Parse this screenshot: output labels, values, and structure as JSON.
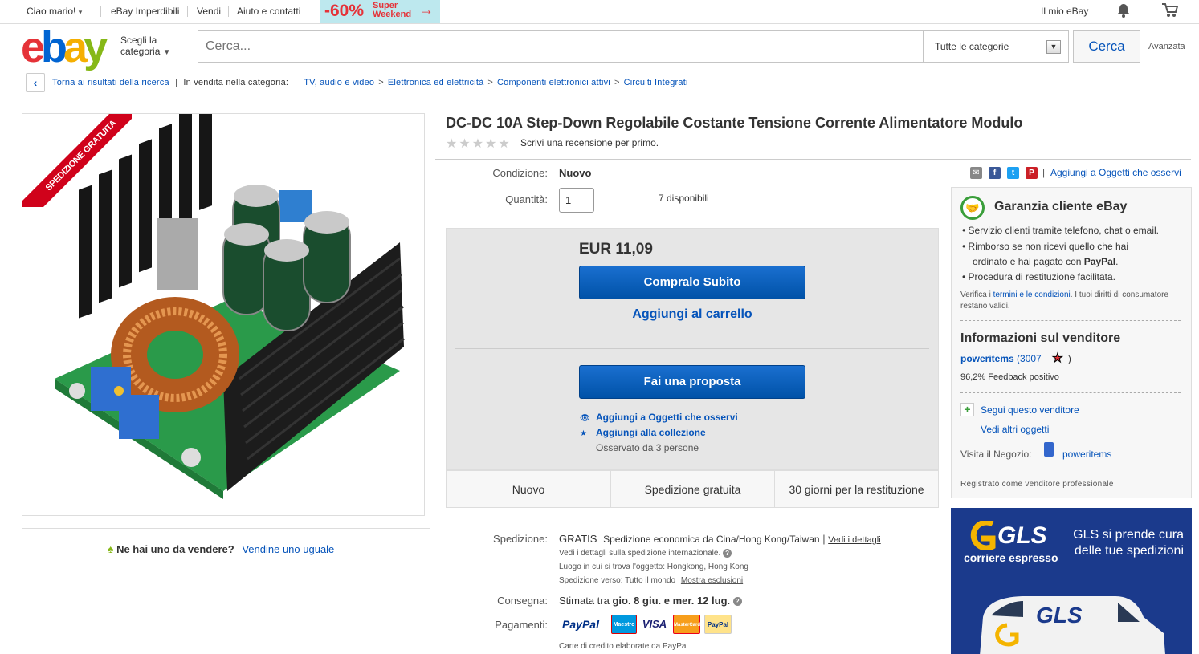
{
  "topbar": {
    "greeting_prefix": "Ciao ",
    "greeting_name": "mario!",
    "caret": "▾",
    "links": [
      "eBay Imperdibili",
      "Vendi",
      "Aiuto e contatti"
    ],
    "promo_pct": "-60%",
    "promo_l1": "Super",
    "promo_l2": "Weekend",
    "promo_arrow": "→",
    "my_ebay": "Il mio eBay",
    "bell": "🔔",
    "cart": "🛒"
  },
  "header": {
    "logo": {
      "e": "e",
      "b": "b",
      "a": "a",
      "y": "y"
    },
    "shop_by_l1": "Scegli la",
    "shop_by_l2": "categoria",
    "shop_by_caret": "▼",
    "search_placeholder": "Cerca...",
    "category": "Tutte le categorie",
    "dropdown": "▼",
    "search_button": "Cerca",
    "advanced": "Avanzata"
  },
  "breadcrumb": {
    "back_icon": "‹",
    "back_text": "Torna ai risultati della ricerca",
    "pipe": "|",
    "in_category": "In vendita nella categoria:",
    "sep": ">",
    "cats": [
      "TV, audio e video",
      "Elettronica ed elettricità",
      "Componenti elettronici attivi",
      "Circuiti Integrati"
    ]
  },
  "item": {
    "ribbon": "SPEDIZIONE GRATUITA",
    "title": "DC-DC 10A Step-Down Regolabile Costante Tensione Corrente Alimentatore Modulo",
    "stars": "★★★★★",
    "review_link": "Scrivi una recensione per primo.",
    "condition_label": "Condizione:",
    "condition": "Nuovo",
    "quantity_label": "Quantità:",
    "quantity": "1",
    "available": "7 disponibili",
    "price": "EUR 11,09",
    "buy_now": "Compralo Subito",
    "add_cart": "Aggiungi al carrello",
    "best_offer": "Fai una proposta",
    "watch_icon": "👁",
    "watch": "Aggiungi a Oggetti che osservi",
    "collect_icon": "★",
    "collect": "Aggiungi alla collezione",
    "observed": "Osservato da 3 persone",
    "features": [
      "Nuovo",
      "Spedizione gratuita",
      "30 giorni per la restituzione"
    ],
    "sell_one_icon": "♠",
    "sell_one_q": "Ne hai uno da vendere?",
    "sell_one_link": "Vendine uno uguale"
  },
  "shipping": {
    "label": "Spedizione:",
    "free": "GRATIS",
    "desc": "Spedizione economica da Cina/Hong Kong/Taiwan",
    "pipe": "|",
    "details": "Vedi i dettagli",
    "intl": "Vedi i dettagli sulla spedizione internazionale.",
    "help": "?",
    "loc_label": "Luogo in cui si trova l'oggetto:",
    "loc": "Hongkong, Hong Kong",
    "to_label": "Spedizione verso:",
    "to": "Tutto il mondo",
    "excl": "Mostra esclusioni",
    "delivery_label": "Consegna:",
    "delivery_prefix": "Stimata tra ",
    "delivery_dates": "gio. 8 giu. e mer. 12 lug.",
    "pay_label": "Pagamenti:",
    "paypal": "PayPal",
    "maestro": "Maestro",
    "visa": "VISA",
    "mastercard": "MasterCard",
    "ppcredit": "PayPal",
    "credit_note": "Carte di credito elaborate da PayPal"
  },
  "share": {
    "email": "✉",
    "fb": "f",
    "tw": "t",
    "pin": "P",
    "pipe": "|",
    "watch_link": "Aggiungi a Oggetti che osservi"
  },
  "guarantee": {
    "icon": "🤝",
    "title": "Garanzia cliente eBay",
    "bullet": "•",
    "items": [
      "Servizio clienti tramite telefono, chat o email.",
      "Rimborso se non ricevi quello che hai",
      "ordinato e hai pagato con ",
      "PayPal",
      ".",
      "Procedura di restituzione facilitata."
    ],
    "verify_l1_a": "Verifica i ",
    "verify_link": "termini e le condizioni",
    "verify_l1_b": ". I tuoi diritti di consumatore",
    "verify_l2": "restano validi."
  },
  "seller": {
    "title": "Informazioni sul venditore",
    "name": "poweritems",
    "score": "(3007",
    "star": "★",
    "close": ")",
    "feedback": "96,2% Feedback positivo",
    "follow_icon": "+",
    "follow": "Segui questo venditore",
    "other": "Vedi altri oggetti",
    "store_label": "Visita il Negozio:",
    "store_icon": "▮",
    "store": "poweritems",
    "registered": "Registrato come venditore professionale"
  },
  "ad": {
    "brand": "GLS",
    "sub": "corriere espresso",
    "tagline_l1": "GLS si prende cura",
    "tagline_l2": "delle tue spedizioni",
    "van_brand": "GLS"
  },
  "colors": {
    "ebay_red": "#e53238",
    "ebay_blue": "#0064d2",
    "ebay_yellow": "#f5af02",
    "ebay_green": "#86b817",
    "link": "#0654ba",
    "button": "#0052a8",
    "gls_blue": "#1b3a8c",
    "gls_yellow": "#f4b400"
  }
}
